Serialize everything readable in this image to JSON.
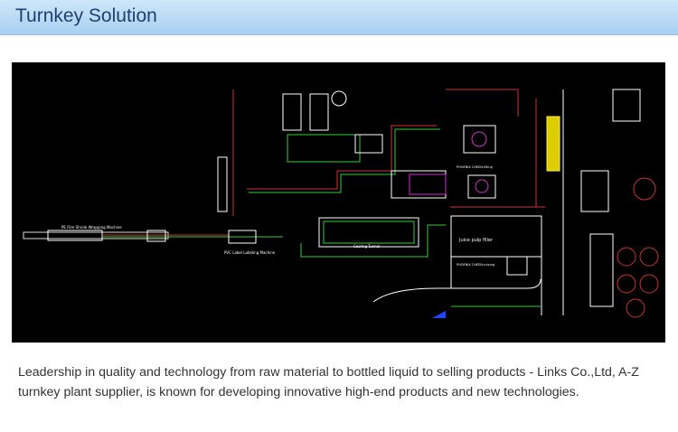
{
  "header": {
    "title": "Turnkey Solution",
    "bg_color": "#bcdcf6",
    "title_color": "#1f3f73"
  },
  "drawing": {
    "description_icon": "cad-plant-layout",
    "background_color": "#000000",
    "labels": {
      "line1": "PE Film Shrink Wrapping Machine",
      "line2": "PVC Label Labeling Machine",
      "line3": "Cooling Tunnel",
      "line4": "Juice pulp filler",
      "line5": "PHOENIX CHEEN-mixing",
      "line6": "PHOENIX CHEEN-filling"
    }
  },
  "caption": {
    "text": "Leadership in quality and technology from raw material to bottled liquid to selling products - Links  Co.,Ltd, A-Z turnkey plant supplier, is known for developing innovative high-end products and new technologies."
  }
}
